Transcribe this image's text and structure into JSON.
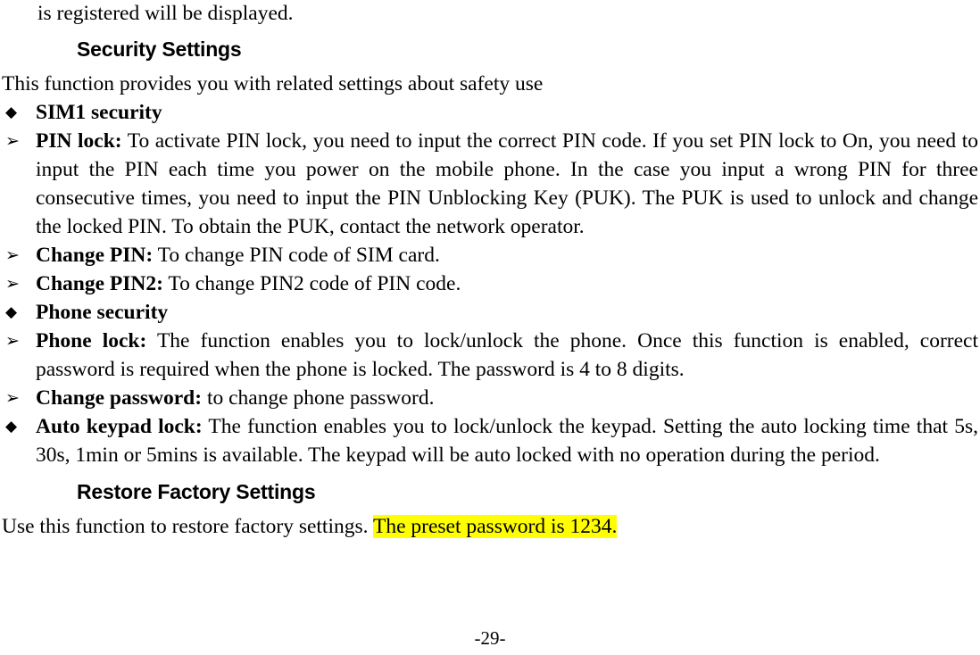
{
  "document": {
    "continuation_line": "is registered will be displayed.",
    "footer_page_number": "-29-"
  },
  "sections": [
    {
      "heading": "Security Settings",
      "intro": "This function provides you with related settings about safety use",
      "items": [
        {
          "bullet": "diamond",
          "bullet_glyph": "◆",
          "label": "SIM1 security",
          "text": ""
        },
        {
          "bullet": "arrow",
          "bullet_glyph": "➢",
          "label": "PIN lock:",
          "text": " To activate PIN lock, you need to input the correct PIN code. If you set PIN lock to On, you need to input the PIN each time you power on the mobile phone. In the case you input a wrong PIN for three consecutive times, you need to input the PIN Unblocking Key (PUK). The PUK is used to unlock and change the locked PIN. To obtain the PUK, contact the network operator."
        },
        {
          "bullet": "arrow",
          "bullet_glyph": "➢",
          "label": "Change PIN:",
          "text": " To change PIN code of SIM card."
        },
        {
          "bullet": "arrow",
          "bullet_glyph": "➢",
          "label": "Change PIN2:",
          "text": " To change PIN2 code of PIN code."
        },
        {
          "bullet": "diamond",
          "bullet_glyph": "◆",
          "label": "Phone security",
          "text": ""
        },
        {
          "bullet": "arrow",
          "bullet_glyph": "➢",
          "label": "Phone lock:",
          "text": " The function enables you to lock/unlock the phone. Once this function is enabled, correct password is required when the phone is locked. The password is 4 to 8 digits."
        },
        {
          "bullet": "arrow",
          "bullet_glyph": "➢",
          "label": "Change password:",
          "text": " to change phone password."
        },
        {
          "bullet": "diamond",
          "bullet_glyph": "◆",
          "label": "Auto keypad lock:",
          "text": " The function enables you to lock/unlock the keypad. Setting the auto locking time that 5s, 30s, 1min or 5mins is available. The keypad will be auto locked with no operation during the period."
        }
      ]
    },
    {
      "heading": "Restore Factory Settings",
      "paragraph_plain": "Use this function to restore factory settings. ",
      "paragraph_highlighted": "The preset password is 1234.",
      "highlight_color": "#FFFF00"
    }
  ]
}
